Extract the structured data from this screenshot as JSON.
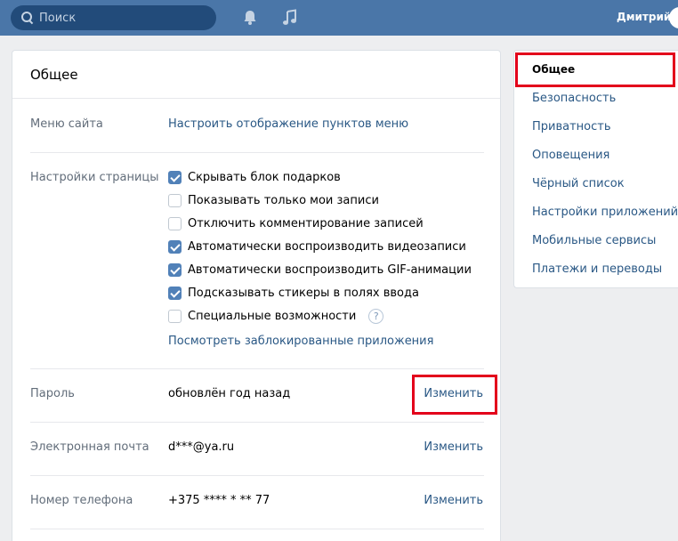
{
  "topbar": {
    "search_placeholder": "Поиск",
    "user_name": "Дмитрий"
  },
  "main": {
    "title": "Общее",
    "site_menu": {
      "label": "Меню сайта",
      "link": "Настроить отображение пунктов меню"
    },
    "page_settings": {
      "label": "Настройки страницы",
      "options": [
        {
          "text": "Скрывать блок подарков",
          "checked": true
        },
        {
          "text": "Показывать только мои записи",
          "checked": false
        },
        {
          "text": "Отключить комментирование записей",
          "checked": false
        },
        {
          "text": "Автоматически воспроизводить видеозаписи",
          "checked": true
        },
        {
          "text": "Автоматически воспроизводить GIF-анимации",
          "checked": true
        },
        {
          "text": "Подсказывать стикеры в полях ввода",
          "checked": true
        },
        {
          "text": "Специальные возможности",
          "checked": false
        }
      ],
      "help_glyph": "?",
      "blocked_apps_link": "Посмотреть заблокированные приложения"
    },
    "password": {
      "label": "Пароль",
      "value": "обновлён год назад",
      "action": "Изменить"
    },
    "email": {
      "label": "Электронная почта",
      "value": "d***@ya.ru",
      "action": "Изменить"
    },
    "phone": {
      "label": "Номер телефона",
      "value": "+375 **** * ** 77",
      "action": "Изменить"
    }
  },
  "sidebar": {
    "items": [
      {
        "label": "Общее",
        "active": true
      },
      {
        "label": "Безопасность",
        "active": false
      },
      {
        "label": "Приватность",
        "active": false
      },
      {
        "label": "Оповещения",
        "active": false
      },
      {
        "label": "Чёрный список",
        "active": false
      },
      {
        "label": "Настройки приложений",
        "active": false
      },
      {
        "label": "Мобильные сервисы",
        "active": false
      },
      {
        "label": "Платежи и переводы",
        "active": false
      }
    ]
  },
  "colors": {
    "topbar": "#4a76a8",
    "link": "#2a5885",
    "checkbox_on": "#5181b8",
    "highlight": "#e3001b"
  }
}
